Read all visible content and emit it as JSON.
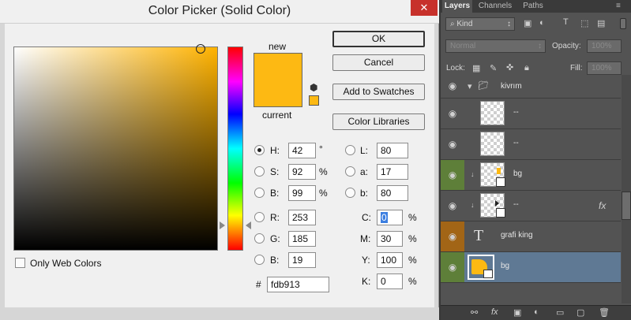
{
  "dialog": {
    "title": "Color Picker (Solid Color)",
    "close_glyph": "✕",
    "new_label": "new",
    "current_label": "current",
    "new_color": "#fdb913",
    "current_color": "#fdb913",
    "buttons": {
      "ok": "OK",
      "cancel": "Cancel",
      "add_swatches": "Add to Swatches",
      "color_libraries": "Color Libraries"
    },
    "only_web_colors": "Only Web Colors",
    "hsb": {
      "h_label": "H:",
      "h_value": "42",
      "h_unit": "°",
      "s_label": "S:",
      "s_value": "92",
      "s_unit": "%",
      "b_label": "B:",
      "b_value": "99",
      "b_unit": "%"
    },
    "rgb": {
      "r_label": "R:",
      "r_value": "253",
      "g_label": "G:",
      "g_value": "185",
      "b_label": "B:",
      "b_value": "19"
    },
    "lab": {
      "l_label": "L:",
      "l_value": "80",
      "a_label": "a:",
      "a_value": "17",
      "b_label": "b:",
      "b_value": "80"
    },
    "cmyk": {
      "c_label": "C:",
      "c_value": "0",
      "m_label": "M:",
      "m_value": "30",
      "y_label": "Y:",
      "y_value": "100",
      "k_label": "K:",
      "k_value": "0",
      "unit": "%"
    },
    "hex_label": "#",
    "hex_value": "fdb913"
  },
  "layers_panel": {
    "tabs": [
      "Layers",
      "Channels",
      "Paths"
    ],
    "filter_label": "Kind",
    "blend_mode": "Normal",
    "opacity_label": "Opacity:",
    "opacity_value": "100%",
    "lock_label": "Lock:",
    "fill_label": "Fill:",
    "fill_value": "100%",
    "layers": [
      {
        "name": "kivrım",
        "kind": "group"
      },
      {
        "name": "--",
        "kind": "pixel"
      },
      {
        "name": "--",
        "kind": "pixel"
      },
      {
        "name": "bg",
        "kind": "pixel"
      },
      {
        "name": "--",
        "kind": "pixel"
      },
      {
        "name": "grafi king",
        "kind": "text"
      },
      {
        "name": "bg",
        "kind": "fill"
      }
    ],
    "fx_label": "fx",
    "accent_colors": {
      "selected": "#5f7994",
      "eye_green": "#5e7f39",
      "eye_brown": "#a26516"
    }
  }
}
